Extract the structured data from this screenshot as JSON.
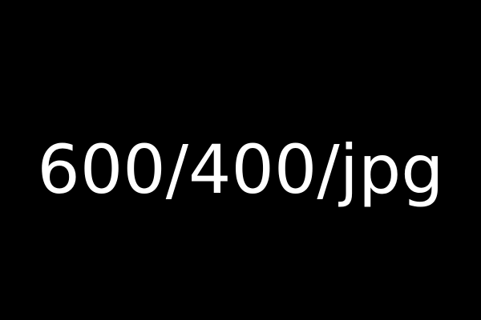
{
  "placeholder": {
    "text": "600/400/jpg"
  },
  "colors": {
    "background": "#000000",
    "text": "#ffffff"
  }
}
